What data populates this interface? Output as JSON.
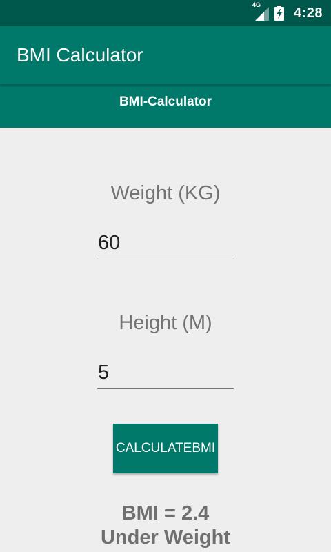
{
  "status_bar": {
    "network": "4G",
    "time": "4:28",
    "signal_icon": "signal-icon",
    "battery_icon": "battery-charging-icon"
  },
  "app_bar": {
    "title": "BMI Calculator"
  },
  "subheader": {
    "title": "BMI-Calculator"
  },
  "weight": {
    "label": "Weight (KG)",
    "value": "60"
  },
  "height": {
    "label": "Height (M)",
    "value": "5"
  },
  "calculate_button": {
    "label": "CALCULATEBMI"
  },
  "result": {
    "bmi": "BMI = 2.4",
    "category": "Under Weight"
  },
  "colors": {
    "status_bar": "#00574b",
    "primary": "#00796b",
    "background": "#eeeeee",
    "label_text": "#737373"
  }
}
